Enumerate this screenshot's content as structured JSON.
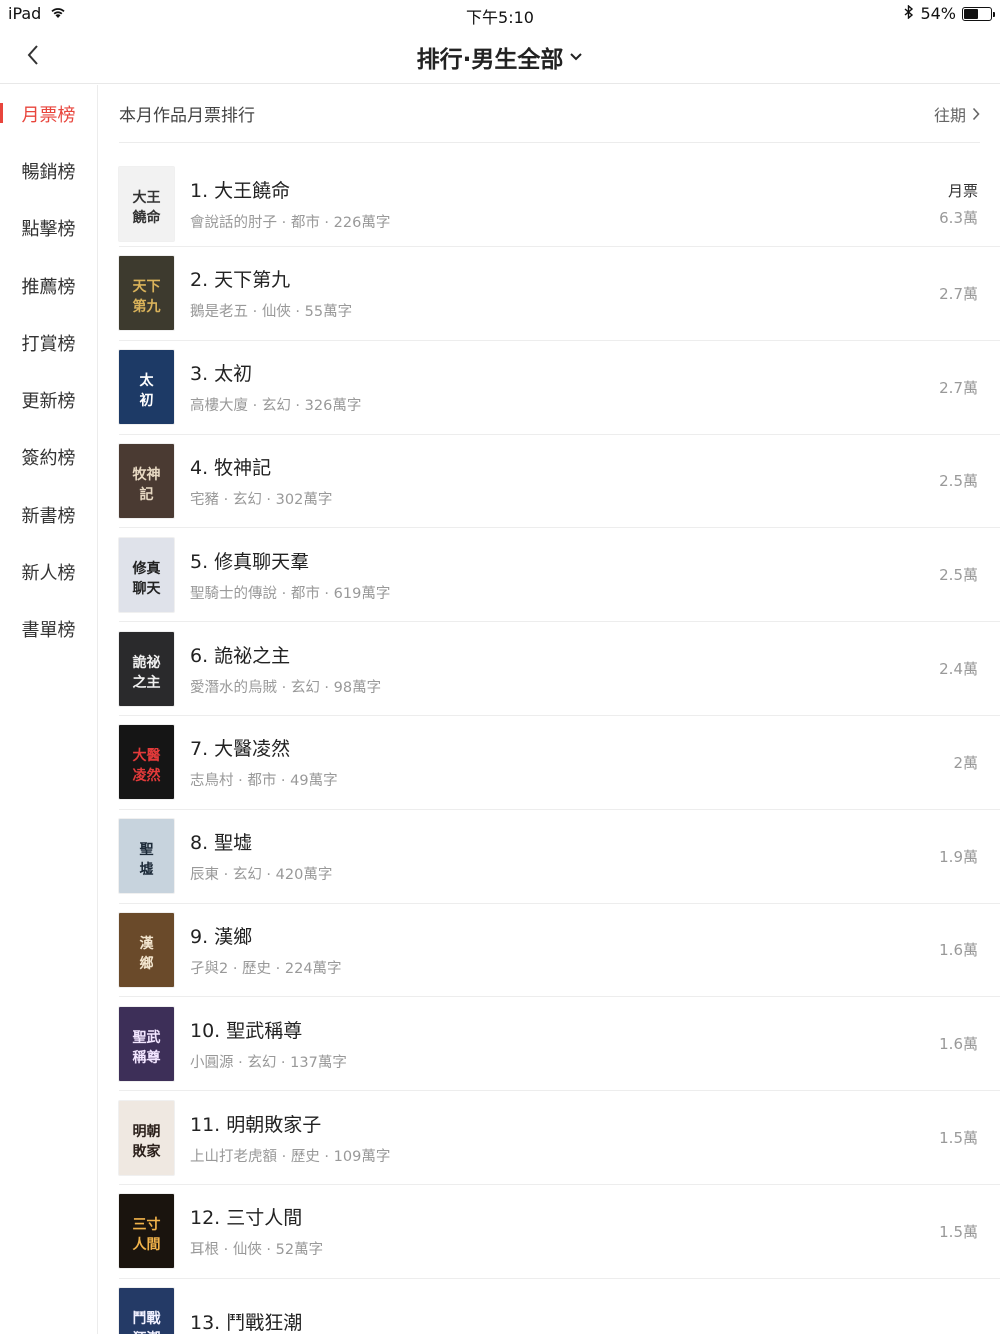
{
  "status_bar": {
    "device": "iPad",
    "time": "下午5:10",
    "battery": "54%",
    "battery_level": 0.54
  },
  "nav": {
    "title": "排行·男生全部"
  },
  "sidebar": {
    "items": [
      {
        "label": "月票榜",
        "active": true
      },
      {
        "label": "暢銷榜"
      },
      {
        "label": "點擊榜"
      },
      {
        "label": "推薦榜"
      },
      {
        "label": "打賞榜"
      },
      {
        "label": "更新榜"
      },
      {
        "label": "簽約榜"
      },
      {
        "label": "新書榜"
      },
      {
        "label": "新人榜"
      },
      {
        "label": "書單榜"
      }
    ]
  },
  "main": {
    "section_title": "本月作品月票排行",
    "past_label": "往期",
    "stat_label": "月票",
    "books": [
      {
        "title": "1. 大王饒命",
        "meta": "會說話的肘子 · 都市 · 226萬字",
        "value": "6.3萬",
        "cover_text": "大王\n饒命",
        "cover_bg": "#f2f2f2",
        "cover_fg": "#333"
      },
      {
        "title": "2. 天下第九",
        "meta": "鵝是老五 · 仙俠 · 55萬字",
        "value": "2.7萬",
        "cover_text": "天下\n第九",
        "cover_bg": "#3d3a2e",
        "cover_fg": "#d9b25a"
      },
      {
        "title": "3. 太初",
        "meta": "高樓大廈 · 玄幻 · 326萬字",
        "value": "2.7萬",
        "cover_text": "太\n初",
        "cover_bg": "#1d3a66",
        "cover_fg": "#ffffff"
      },
      {
        "title": "4. 牧神記",
        "meta": "宅豬 · 玄幻 · 302萬字",
        "value": "2.5萬",
        "cover_text": "牧神\n記",
        "cover_bg": "#4a3a32",
        "cover_fg": "#e7d8c2"
      },
      {
        "title": "5. 修真聊天羣",
        "meta": "聖騎士的傳說 · 都市 · 619萬字",
        "value": "2.5萬",
        "cover_text": "修真\n聊天",
        "cover_bg": "#dfe2ea",
        "cover_fg": "#222"
      },
      {
        "title": "6. 詭祕之主",
        "meta": "愛潛水的烏賊 · 玄幻 · 98萬字",
        "value": "2.4萬",
        "cover_text": "詭祕\n之主",
        "cover_bg": "#2a2a2c",
        "cover_fg": "#f0f0f0"
      },
      {
        "title": "7. 大醫凌然",
        "meta": "志鳥村 · 都市 · 49萬字",
        "value": "2萬",
        "cover_text": "大醫\n凌然",
        "cover_bg": "#151515",
        "cover_fg": "#e23a3a"
      },
      {
        "title": "8. 聖墟",
        "meta": "辰東 · 玄幻 · 420萬字",
        "value": "1.9萬",
        "cover_text": "聖\n墟",
        "cover_bg": "#c7d3dd",
        "cover_fg": "#1c2a38"
      },
      {
        "title": "9. 漢鄉",
        "meta": "孑與2 · 歷史 · 224萬字",
        "value": "1.6萬",
        "cover_text": "漢\n鄉",
        "cover_bg": "#6a4a2a",
        "cover_fg": "#f3e6cf"
      },
      {
        "title": "10. 聖武稱尊",
        "meta": "小圓源 · 玄幻 · 137萬字",
        "value": "1.6萬",
        "cover_text": "聖武\n稱尊",
        "cover_bg": "#3d2f58",
        "cover_fg": "#f2e5ff"
      },
      {
        "title": "11. 明朝敗家子",
        "meta": "上山打老虎額 · 歷史 · 109萬字",
        "value": "1.5萬",
        "cover_text": "明朝\n敗家",
        "cover_bg": "#efe8e1",
        "cover_fg": "#2a1f1a"
      },
      {
        "title": "12. 三寸人間",
        "meta": "耳根 · 仙俠 · 52萬字",
        "value": "1.5萬",
        "cover_text": "三寸\n人間",
        "cover_bg": "#1a140e",
        "cover_fg": "#f0b24a"
      },
      {
        "title": "13. 鬥戰狂潮",
        "meta": "",
        "value": "",
        "cover_text": "鬥戰\n狂潮",
        "cover_bg": "#243a66",
        "cover_fg": "#f0f0ff"
      }
    ]
  },
  "colors": {
    "accent": "#e8453c",
    "meta_text": "#999999",
    "divider": "#ececec"
  }
}
